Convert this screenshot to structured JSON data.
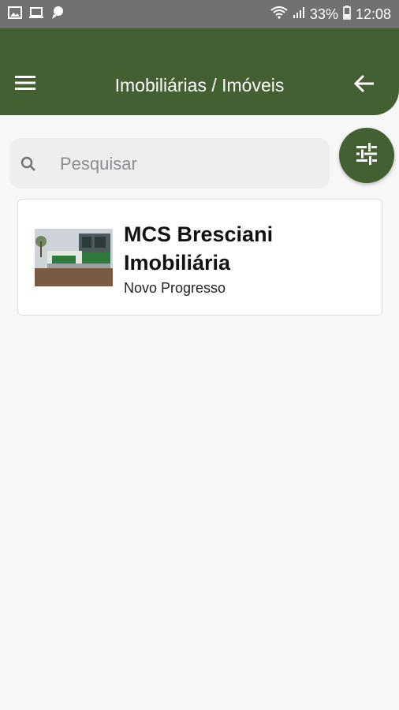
{
  "status_bar": {
    "battery": "33%",
    "time": "12:08",
    "icons": [
      "gallery-icon",
      "laptop-icon",
      "chat-icon",
      "wifi-icon",
      "signal-icon",
      "battery-icon"
    ]
  },
  "app_bar": {
    "title": "Imobiliárias / Imóveis",
    "menu_icon": "menu-icon",
    "back_icon": "arrow-back-icon"
  },
  "search": {
    "placeholder": "Pesquisar",
    "value": ""
  },
  "filter": {
    "icon": "tune-icon"
  },
  "colors": {
    "primary": "#445f31",
    "status_bar": "#717171",
    "background": "#f7f7f7"
  },
  "listings": [
    {
      "name": "MCS Bresciani Imobiliária",
      "city": "Novo Progresso"
    }
  ]
}
